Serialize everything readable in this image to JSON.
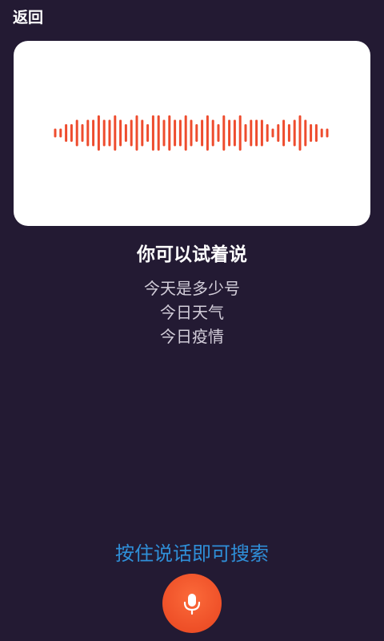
{
  "header": {
    "back_label": "返回"
  },
  "waveform": {
    "color": "#ee4c2e",
    "levels": [
      0.25,
      0.25,
      0.5,
      0.5,
      0.75,
      0.5,
      0.75,
      0.75,
      1.0,
      0.75,
      0.75,
      1.0,
      0.75,
      0.5,
      0.75,
      1.0,
      0.75,
      0.5,
      1.0,
      1.0,
      0.75,
      1.0,
      0.75,
      0.75,
      1.0,
      0.75,
      0.5,
      0.75,
      1.0,
      0.75,
      0.5,
      1.0,
      0.75,
      0.75,
      1.0,
      0.5,
      0.75,
      0.75,
      0.75,
      0.5,
      0.25,
      0.5,
      0.75,
      0.5,
      0.75,
      1.0,
      0.75,
      0.5,
      0.5,
      0.25,
      0.25
    ]
  },
  "hint": {
    "title": "你可以试着说",
    "suggestions": [
      "今天是多少号",
      "今日天气",
      "今日疫情"
    ]
  },
  "footer": {
    "prompt": "按住说话即可搜索",
    "prompt_color": "#2f8fd8",
    "mic_icon": "microphone-icon",
    "mic_button_color": "#f0532a"
  },
  "colors": {
    "background": "#231a33",
    "card": "#ffffff"
  }
}
